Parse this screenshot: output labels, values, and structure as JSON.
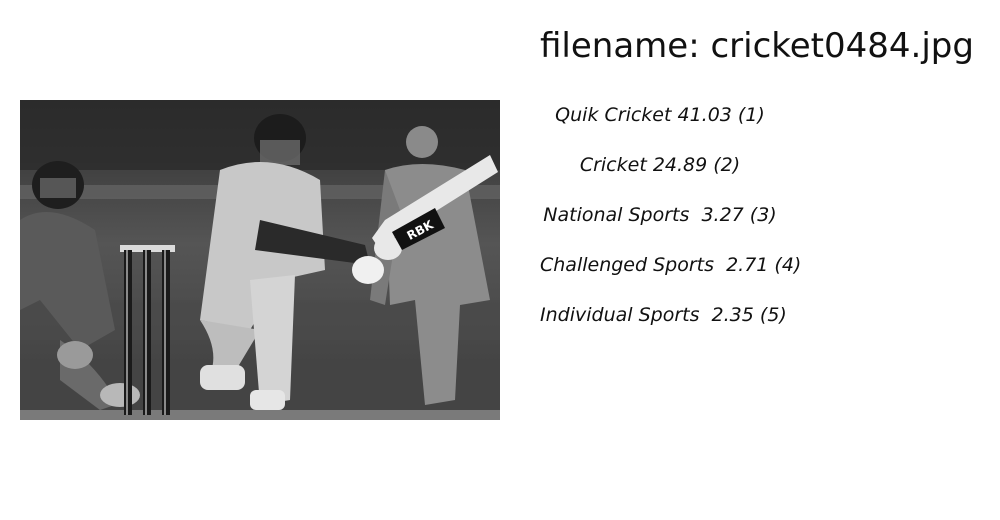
{
  "header": {
    "filename_label": "filename: cricket0484.jpg"
  },
  "photo": {
    "subject_icon": "cricket-batsman-photo",
    "grayscale": true,
    "bat_logo_text": "RBK"
  },
  "predictions": [
    {
      "text": "Quik Cricket 41.03 (1)"
    },
    {
      "text": "Cricket 24.89 (2)"
    },
    {
      "text": "National Sports  3.27 (3)"
    },
    {
      "text": "Challenged Sports  2.71 (4)"
    },
    {
      "text": "Individual Sports  2.35 (5)"
    }
  ]
}
